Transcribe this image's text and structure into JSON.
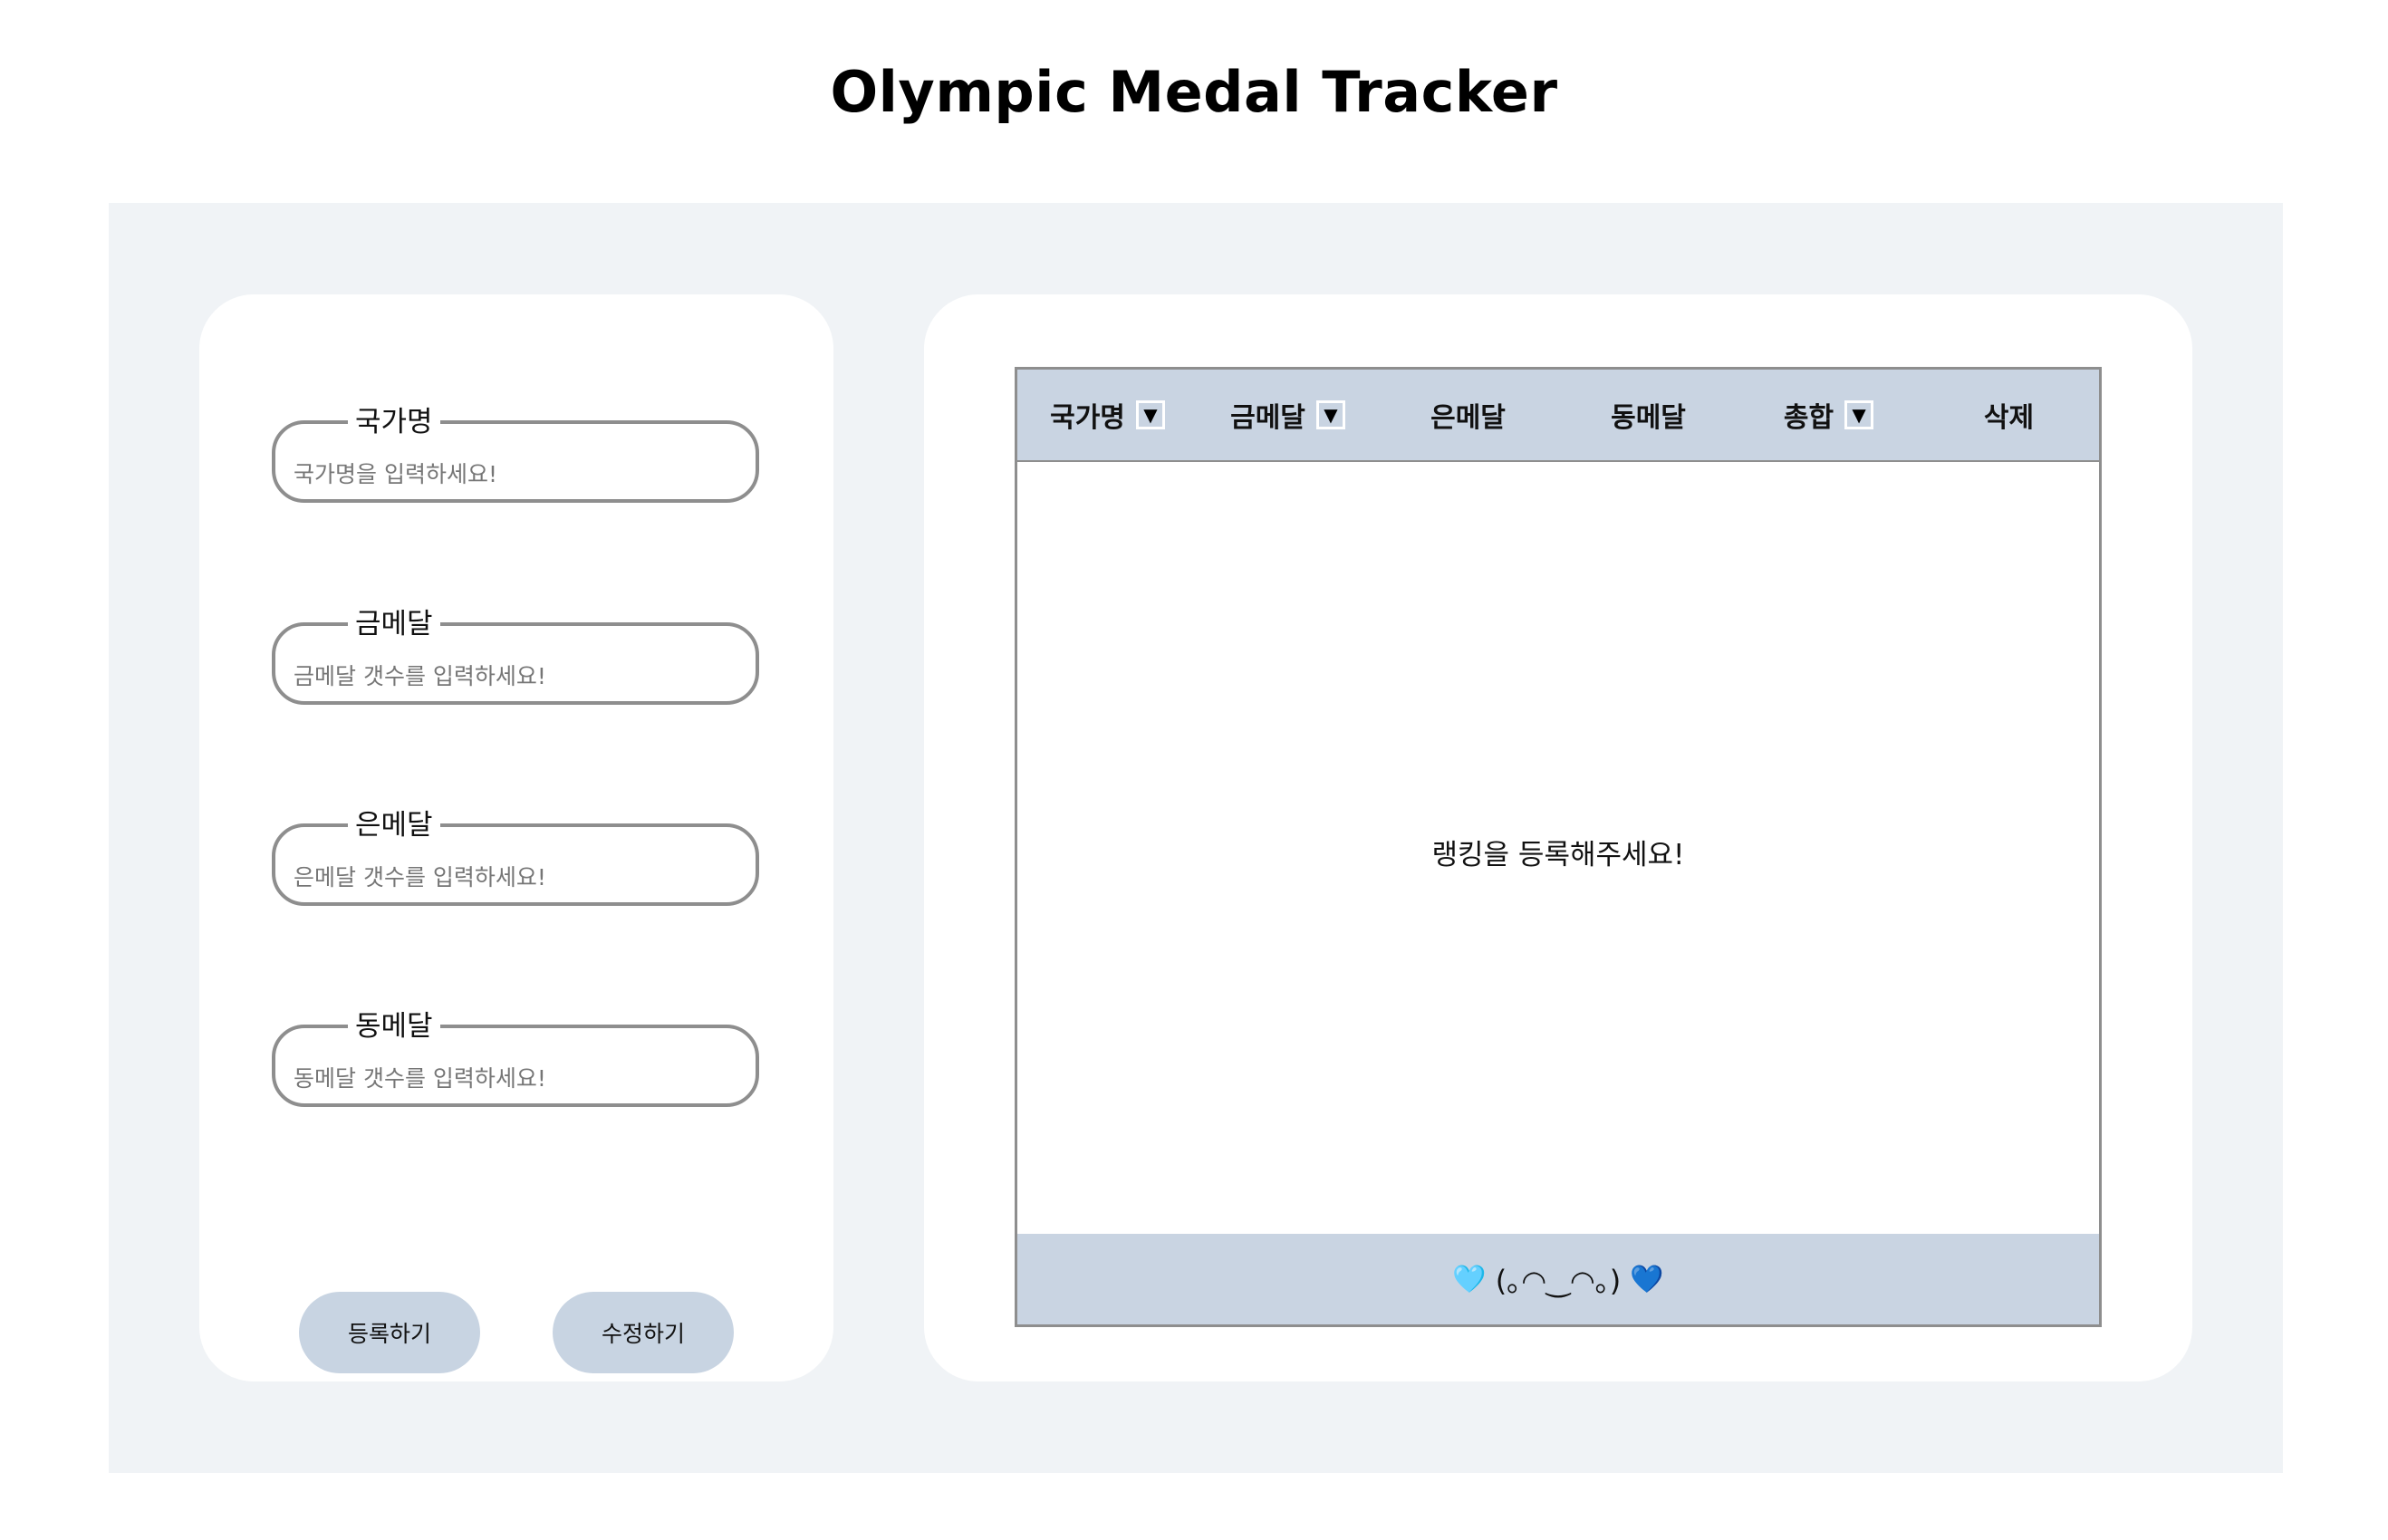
{
  "title": "Olympic Medal Tracker",
  "form": {
    "fields": [
      {
        "label": "국가명",
        "placeholder": "국가명을 입력하세요!",
        "value": ""
      },
      {
        "label": "금메달",
        "placeholder": "금메달 갯수를 입력하세요!",
        "value": ""
      },
      {
        "label": "은메달",
        "placeholder": "은메달 갯수를 입력하세요!",
        "value": ""
      },
      {
        "label": "동메달",
        "placeholder": "동메달 갯수를 입력하세요!",
        "value": ""
      }
    ],
    "register_label": "등록하기",
    "edit_label": "수정하기"
  },
  "table": {
    "columns": [
      {
        "label": "국가명",
        "sort_icon": "▼"
      },
      {
        "label": "금메달",
        "sort_icon": "▼"
      },
      {
        "label": "은메달"
      },
      {
        "label": "동메달"
      },
      {
        "label": "총합",
        "sort_icon": "▼"
      },
      {
        "label": "삭제"
      }
    ],
    "rows": [],
    "empty_message": "랭킹을 등록해주세요!",
    "footer": {
      "heart_left": "🩵",
      "kaomoji": "(｡◠‿◠｡)",
      "heart_right": "💙"
    }
  },
  "colors": {
    "accent": "#c9d4e2",
    "background": "#f0f3f6",
    "border": "#8e8e8e"
  }
}
